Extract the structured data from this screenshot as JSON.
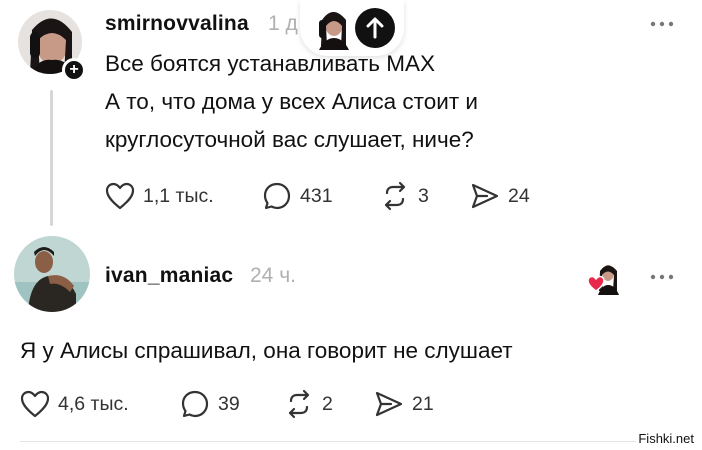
{
  "post1": {
    "username": "smirnovvalina",
    "time": "1 д",
    "text_lines": [
      "Все боятся устанавливать MAX",
      "А то, что дома у всех Алиса стоит и",
      "круглосуточной вас слушает, ниче?"
    ],
    "likes": "1,1 тыс.",
    "comments": "431",
    "reposts": "3",
    "shares": "24"
  },
  "post2": {
    "username": "ivan_maniac",
    "time": "24 ч.",
    "text": "Я у Алисы спрашивал, она говорит не слушает",
    "likes": "4,6 тыс.",
    "comments": "39",
    "reposts": "2",
    "shares": "21"
  },
  "watermark": "Fishki.net",
  "icons": {
    "like": "heart-icon",
    "comment": "comment-bubble-icon",
    "repost": "repost-icon",
    "share": "send-icon",
    "more": "more-dots-icon",
    "scroll_up": "arrow-up-icon",
    "follow": "plus-icon"
  },
  "colors": {
    "text": "#111111",
    "muted": "#b0b0b0",
    "like_red": "#e8274b"
  }
}
